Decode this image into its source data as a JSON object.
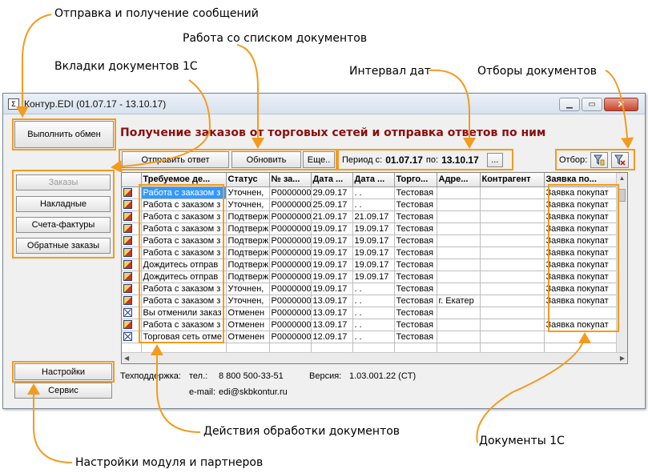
{
  "callouts": {
    "exchange": "Отправка и получение сообщений",
    "doc_list": "Работа со списком документов",
    "tabs": "Вкладки документов 1С",
    "date_range": "Интервал дат",
    "filters": "Отборы документов",
    "actions": "Действия обработки документов",
    "docs_1c": "Документы 1С",
    "settings": "Настройки модуля и партнеров"
  },
  "window": {
    "title": "Контур.EDI (01.07.17 - 13.10.17)",
    "app_icon": "Σ"
  },
  "buttons": {
    "run_exchange": "Выполнить обмен",
    "send_reply": "Отправить ответ",
    "refresh": "Обновить",
    "more": "Еще..",
    "period_pick": "...",
    "settings": "Настройки",
    "service": "Сервис"
  },
  "heading": "Получение заказов от торговых сетей и отправка ответов по ним",
  "tabs": [
    {
      "label": "Заказы",
      "disabled": true
    },
    {
      "label": "Накладные",
      "disabled": false
    },
    {
      "label": "Счета-фактуры",
      "disabled": false
    },
    {
      "label": "Обратные заказы",
      "disabled": false
    }
  ],
  "period": {
    "from_label": "Период с:",
    "from": "01.07.17",
    "to_label": "по:",
    "to": "13.10.17"
  },
  "filter": {
    "label": "Отбор:",
    "icons": [
      "filter-set-icon",
      "filter-clear-icon"
    ]
  },
  "table": {
    "columns": [
      "",
      "Требуемое де...",
      "Статус",
      "№ за...",
      "Дата ...",
      "Дата ...",
      "Торго...",
      "Адре...",
      "Контрагент",
      "Заявка по..."
    ],
    "rows": [
      {
        "icon": "doc",
        "cells": [
          "Работа с заказом з",
          "Уточнен,",
          "P0000000",
          "29.09.17",
          "  .  .",
          "Тестовая",
          "",
          "",
          "Заявка покупат"
        ],
        "selected": true
      },
      {
        "icon": "doc",
        "cells": [
          "Работа с заказом з",
          "Уточнен,",
          "P0000000",
          "25.09.17",
          "  .  .",
          "Тестовая",
          "",
          "",
          "Заявка покупат"
        ]
      },
      {
        "icon": "doc",
        "cells": [
          "Работа с заказом з",
          "Подтверж",
          "P0000000",
          "21.09.17",
          "21.09.17",
          "Тестовая",
          "",
          "",
          "Заявка покупат"
        ]
      },
      {
        "icon": "doc",
        "cells": [
          "Работа с заказом з",
          "Подтверж",
          "P0000000",
          "19.09.17",
          "19.09.17",
          "Тестовая",
          "",
          "",
          "Заявка покупат"
        ]
      },
      {
        "icon": "doc",
        "cells": [
          "Работа с заказом з",
          "Подтверж",
          "P0000000",
          "19.09.17",
          "19.09.17",
          "Тестовая",
          "",
          "",
          "Заявка покупат"
        ]
      },
      {
        "icon": "doc",
        "cells": [
          "Работа с заказом з",
          "Подтверж",
          "P0000000",
          "19.09.17",
          "19.09.17",
          "Тестовая",
          "",
          "",
          "Заявка покупат"
        ]
      },
      {
        "icon": "doc",
        "cells": [
          "Дождитесь отправ",
          "Подтверж",
          "P0000000",
          "19.09.17",
          "19.09.17",
          "Тестовая",
          "",
          "",
          "Заявка покупат"
        ]
      },
      {
        "icon": "doc",
        "cells": [
          "Дождитесь отправ",
          "Подтверж",
          "P0000000",
          "19.09.17",
          "19.09.17",
          "Тестовая",
          "",
          "",
          "Заявка покупат"
        ]
      },
      {
        "icon": "doc",
        "cells": [
          "Работа с заказом з",
          "Уточнен,",
          "P0000000",
          "19.09.17",
          "  .  .",
          "Тестовая",
          "",
          "",
          "Заявка покупат"
        ]
      },
      {
        "icon": "doc",
        "cells": [
          "Работа с заказом з",
          "Уточнен,",
          "P0000000",
          "13.09.17",
          "  .  .",
          "Тестовая",
          "г. Екатер",
          "",
          "Заявка покупат"
        ]
      },
      {
        "icon": "x",
        "cells": [
          "Вы отменили заказ",
          "Отменен",
          "P0000000",
          "13.09.17",
          "  .  .",
          "Тестовая",
          "",
          "",
          ""
        ]
      },
      {
        "icon": "doc",
        "cells": [
          "Работа с заказом з",
          "Отменен",
          "P0000000",
          "13.09.17",
          "  .  .",
          "Тестовая",
          "",
          "",
          "Заявка покупат"
        ]
      },
      {
        "icon": "x",
        "cells": [
          "Торговая сеть отме",
          "Отменен",
          "P0000000",
          "12.09.17",
          "  .  .",
          "Тестовая",
          "",
          "",
          ""
        ]
      }
    ]
  },
  "support": {
    "label": "Техподдержка:",
    "phone_label": "тел.:",
    "phone": "8 800 500-33-51",
    "email_label": "e-mail:",
    "email": "edi@skbkontur.ru",
    "version_label": "Версия:",
    "version": "1.03.001.22 (CT)"
  },
  "colors": {
    "accent_highlight": "#f39b1e",
    "heading": "#8a0e0e",
    "selection": "#3399ff"
  }
}
